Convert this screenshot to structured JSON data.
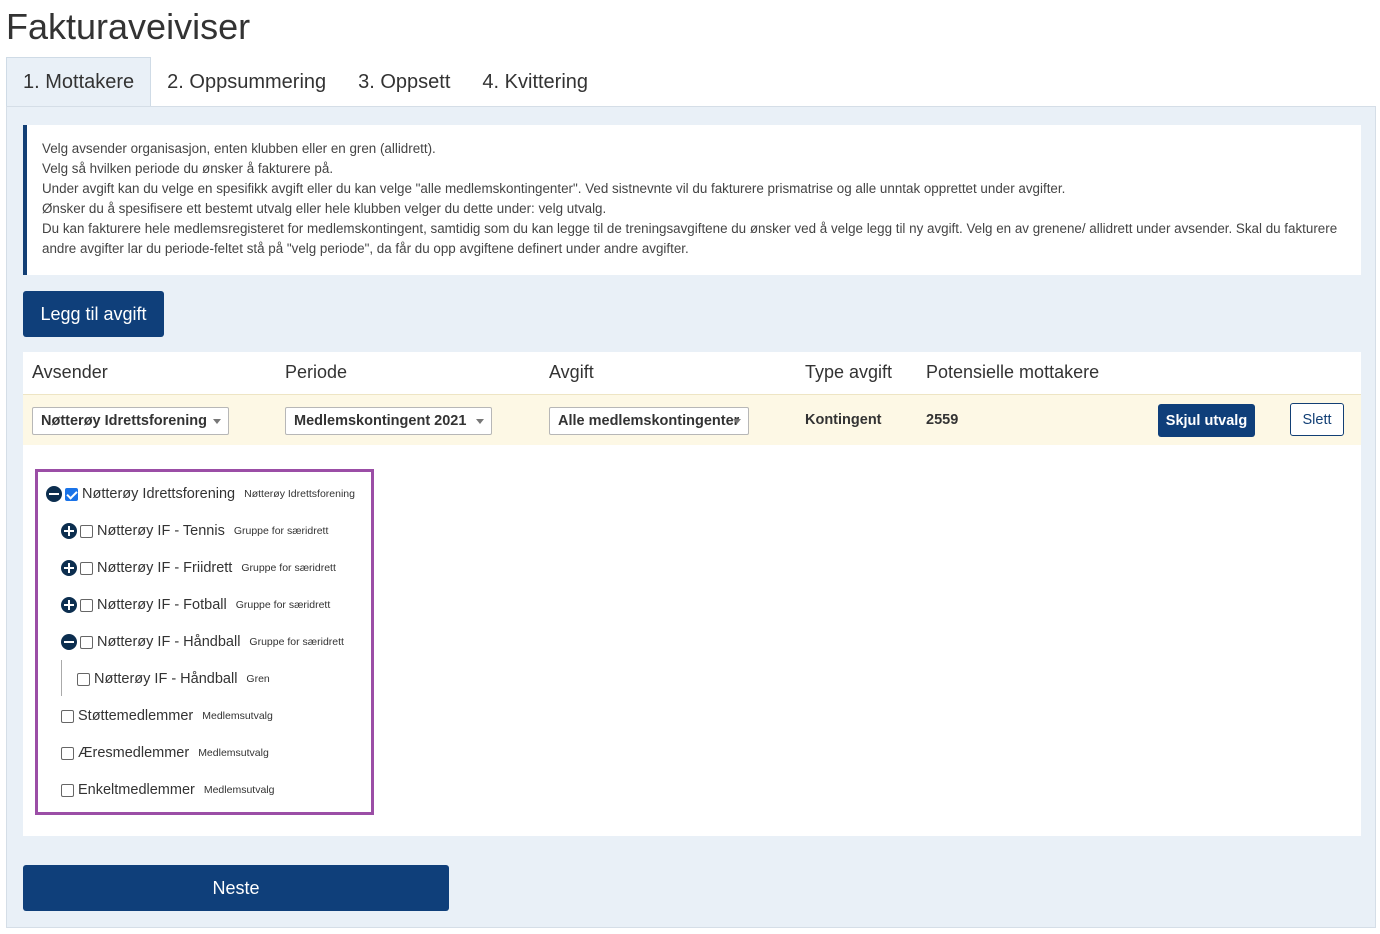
{
  "page": {
    "title": "Fakturaveiviser"
  },
  "tabs": [
    {
      "label": "1. Mottakere"
    },
    {
      "label": "2. Oppsummering"
    },
    {
      "label": "3. Oppsett"
    },
    {
      "label": "4. Kvittering"
    }
  ],
  "info": {
    "lines": [
      "Velg avsender organisasjon, enten klubben eller en gren (allidrett).",
      "Velg så hvilken periode du ønsker å fakturere på.",
      "Under avgift kan du velge en spesifikk avgift eller du kan velge \"alle medlemskontingenter\". Ved sistnevnte vil du fakturere prismatrise og alle unntak opprettet under avgifter.",
      "Ønsker du å spesifisere ett bestemt utvalg eller hele klubben velger du dette under: velg utvalg.",
      "Du kan fakturere hele medlemsregisteret for medlemskontingent, samtidig som du kan legge til de treningsavgiftene du ønsker ved å velge legg til ny avgift. Velg en av grenene/ allidrett under avsender. Skal du fakturere andre avgifter lar du periode-feltet stå på \"velg periode\", da får du opp avgiftene definert under andre avgifter."
    ]
  },
  "buttons": {
    "add_fee": "Legg til avgift",
    "hide_selection": "Skjul utvalg",
    "delete": "Slett",
    "next": "Neste"
  },
  "table": {
    "headers": {
      "sender": "Avsender",
      "period": "Periode",
      "fee": "Avgift",
      "fee_type": "Type avgift",
      "recipients": "Potensielle mottakere"
    },
    "row": {
      "sender": "Nøtterøy Idrettsforening",
      "period": "Medlemskontingent 2021",
      "fee": "Alle medlemskontingenter",
      "fee_type": "Kontingent",
      "recipients": "2559"
    }
  },
  "tree": [
    {
      "name": "Nøtterøy Idrettsforening",
      "type": "Nøtterøy Idrettsforening",
      "checked": true,
      "toggle": "minus"
    },
    {
      "name": "Nøtterøy IF - Tennis",
      "type": "Gruppe for særidrett",
      "checked": false,
      "toggle": "plus"
    },
    {
      "name": "Nøtterøy IF - Friidrett",
      "type": "Gruppe for særidrett",
      "checked": false,
      "toggle": "plus"
    },
    {
      "name": "Nøtterøy IF - Fotball",
      "type": "Gruppe for særidrett",
      "checked": false,
      "toggle": "plus"
    },
    {
      "name": "Nøtterøy IF - Håndball",
      "type": "Gruppe for særidrett",
      "checked": false,
      "toggle": "minus"
    },
    {
      "name": "Nøtterøy IF - Håndball",
      "type": "Gren",
      "checked": false,
      "toggle": "none"
    },
    {
      "name": "Støttemedlemmer",
      "type": "Medlemsutvalg",
      "checked": false,
      "toggle": "none"
    },
    {
      "name": "Æresmedlemmer",
      "type": "Medlemsutvalg",
      "checked": false,
      "toggle": "none"
    },
    {
      "name": "Enkeltmedlemmer",
      "type": "Medlemsutvalg",
      "checked": false,
      "toggle": "none"
    }
  ],
  "colors": {
    "primary": "#0f3f7a",
    "panel_bg": "#e9f0f7",
    "row_bg": "#fdf8e5",
    "highlight_border": "#9b4ea6",
    "checkbox_checked": "#1a73e8"
  }
}
